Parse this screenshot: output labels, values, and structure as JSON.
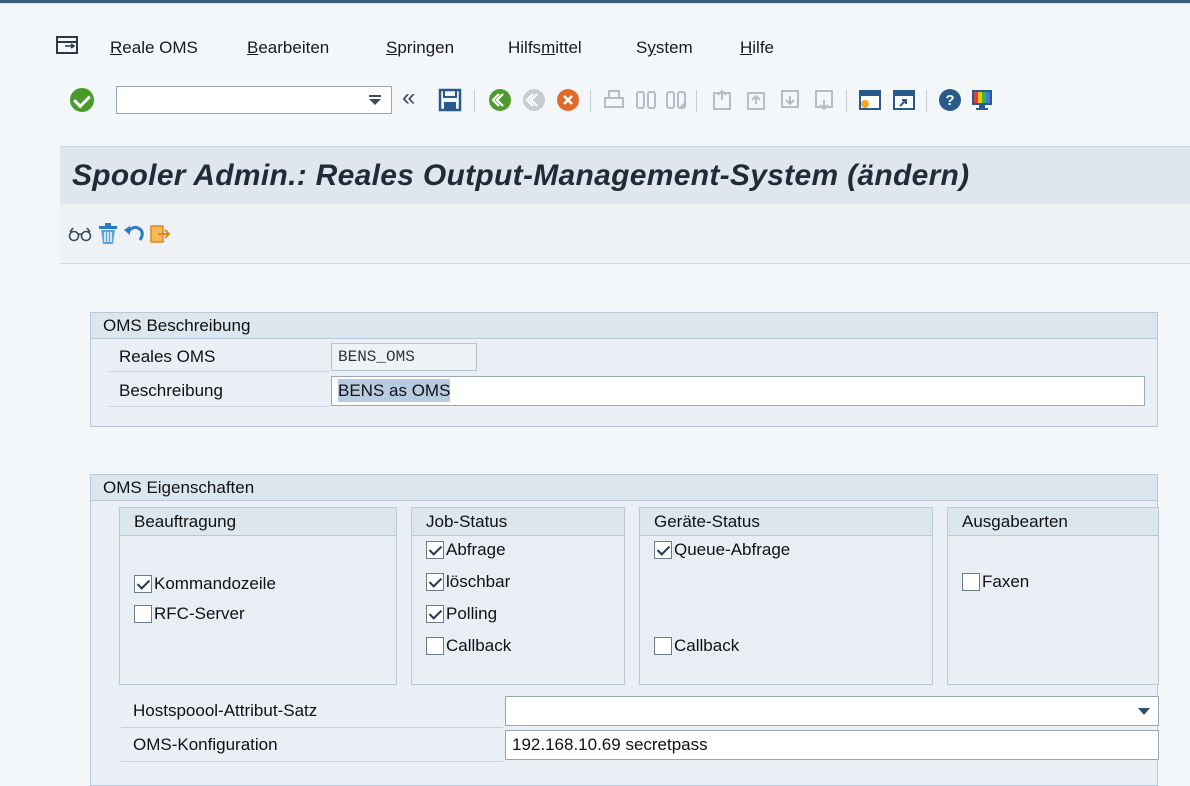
{
  "menu": {
    "items": [
      {
        "pre": "",
        "u": "R",
        "post": "eale OMS"
      },
      {
        "pre": "",
        "u": "B",
        "post": "earbeiten"
      },
      {
        "pre": "",
        "u": "S",
        "post": "pringen"
      },
      {
        "pre": "Hilfs",
        "u": "m",
        "post": "ittel"
      },
      {
        "pre": "S",
        "u": "y",
        "post": "stem"
      },
      {
        "pre": "",
        "u": "H",
        "post": "ilfe"
      }
    ]
  },
  "toolbar": {
    "command_value": "",
    "back_glyph": "«"
  },
  "page": {
    "title": "Spooler Admin.: Reales Output-Management-System (ändern)"
  },
  "desc_group": {
    "title": "OMS Beschreibung",
    "oms_label": "Reales OMS",
    "oms_value": "BENS_OMS",
    "beschr_label": "Beschreibung",
    "beschr_value": "BENS as OMS"
  },
  "props_group": {
    "title": "OMS Eigenschaften",
    "beauftragung": {
      "title": "Beauftragung",
      "items": [
        {
          "label": "Kommandozeile",
          "checked": true
        },
        {
          "label": "RFC-Server",
          "checked": false
        }
      ]
    },
    "jobstatus": {
      "title": "Job-Status",
      "items": [
        {
          "label": "Abfrage",
          "checked": true
        },
        {
          "label": "löschbar",
          "checked": true
        },
        {
          "label": "Polling",
          "checked": true
        },
        {
          "label": "Callback",
          "checked": false
        }
      ]
    },
    "geraetestatus": {
      "title": "Geräte-Status",
      "items": [
        {
          "label": "Queue-Abfrage",
          "checked": true
        },
        {
          "label": "Callback",
          "checked": false
        }
      ]
    },
    "ausgabearten": {
      "title": "Ausgabearten",
      "items": [
        {
          "label": "Faxen",
          "checked": false
        }
      ]
    },
    "hostspool_label": "Hostspoool-Attribut-Satz",
    "hostspool_value": "",
    "config_label": "OMS-Konfiguration",
    "config_value": "192.168.10.69 secretpass"
  }
}
